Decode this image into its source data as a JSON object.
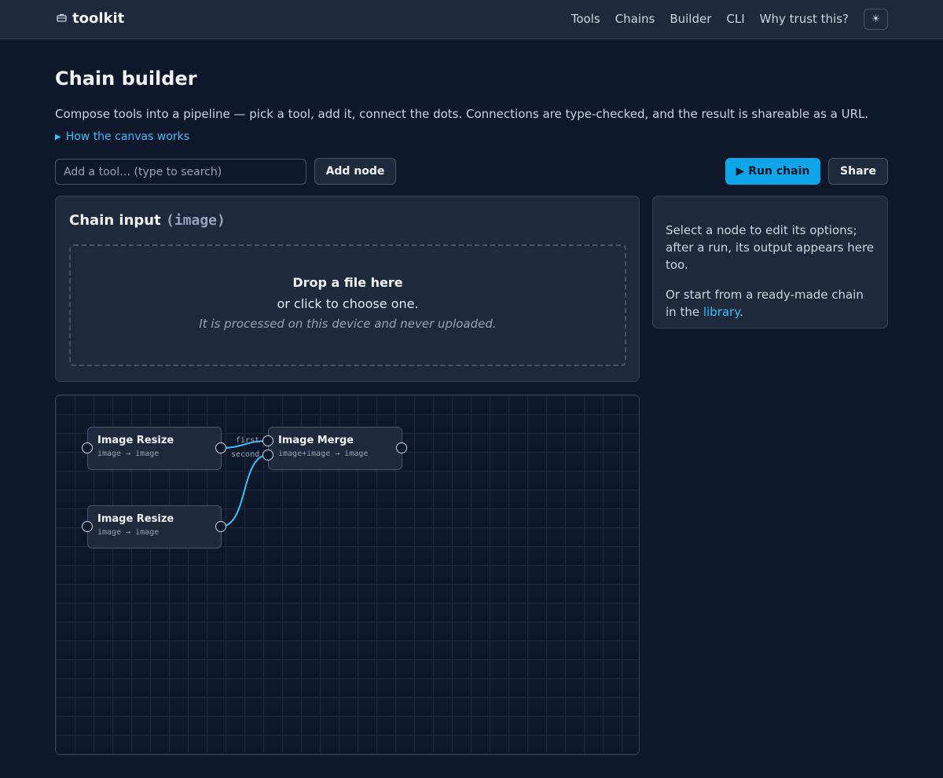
{
  "header": {
    "brand_icon": "toolbox-icon",
    "brand": "toolkit",
    "nav": [
      "Tools",
      "Chains",
      "Builder",
      "CLI",
      "Why trust this?"
    ],
    "theme_icon": "☀"
  },
  "page": {
    "title": "Chain builder",
    "description": "Compose tools into a pipeline — pick a tool, add it, connect the dots. Connections are type-checked, and the result is shareable as a URL.",
    "details_label": "How the canvas works"
  },
  "toolbar": {
    "search_placeholder": "Add a tool… (type to search)",
    "add_node": "Add node",
    "run_chain": "▶ Run chain",
    "share": "Share"
  },
  "chain_input": {
    "title": "Chain input",
    "type": "(image)",
    "drop_main": "Drop a file here",
    "drop_sub": "or click to choose one.",
    "drop_note": "It is processed on this device and never uploaded."
  },
  "side_panel": {
    "text1": "Select a node to edit its options; after a run, its output appears here too.",
    "text2_pre": "Or start from a ready-made chain in the",
    "text2_link": "library",
    "text2_post": "."
  },
  "nodes": [
    {
      "title": "Image Resize",
      "signature": "image → image"
    },
    {
      "title": "Image Resize",
      "signature": "image → image"
    },
    {
      "title": "Image Merge",
      "signature": "image+image → image",
      "inputs": [
        "first",
        "second"
      ]
    }
  ],
  "colors": {
    "accent": "#0ea5e9",
    "link": "#38bdf8",
    "background": "#0f172a",
    "panel": "#1e293b"
  }
}
